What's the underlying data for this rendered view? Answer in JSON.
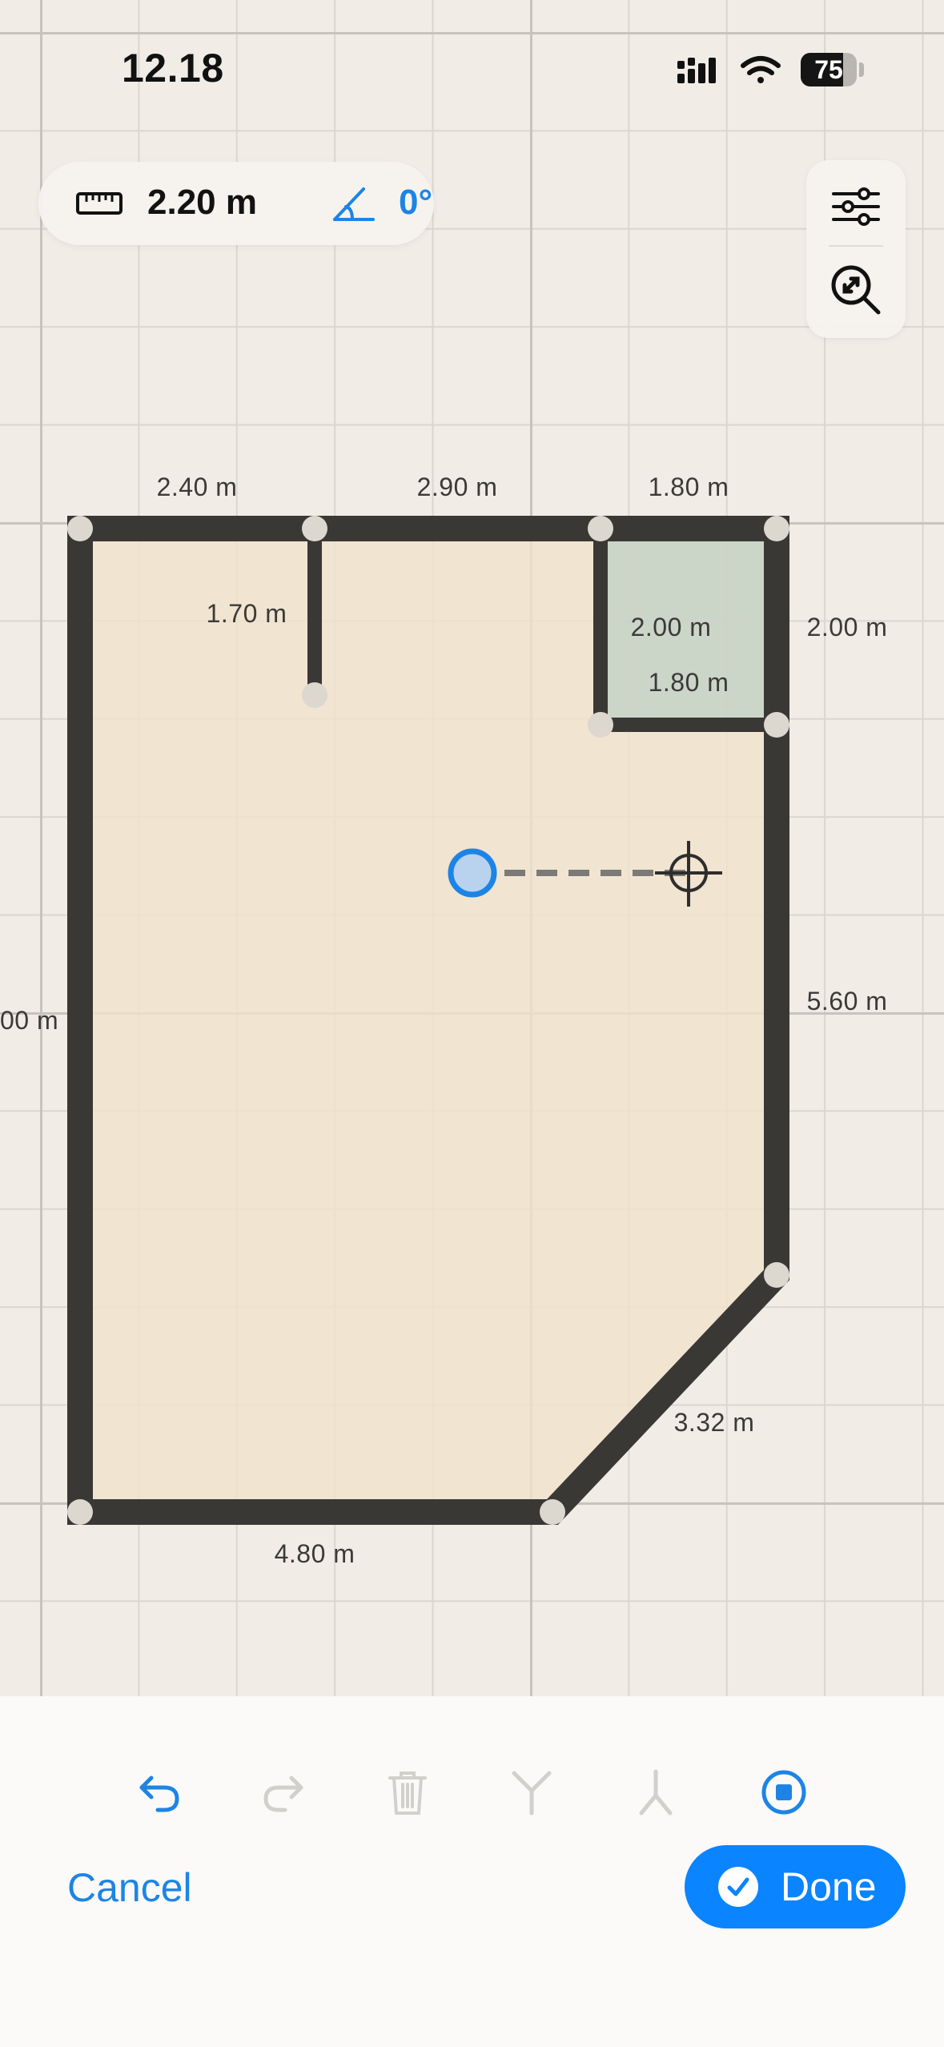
{
  "status_bar": {
    "time": "12.18",
    "battery_level": "75",
    "battery_fraction": 0.75
  },
  "measurement": {
    "length": "2.20 m",
    "angle": "0°",
    "length_icon": "ruler-icon",
    "angle_icon": "angle-icon"
  },
  "canvas_tools": {
    "settings_icon": "sliders-icon",
    "zoom_icon": "zoom-to-fit-icon"
  },
  "floor_plan": {
    "wall_labels": {
      "top_left": "2.40 m",
      "top_middle": "2.90 m",
      "top_right": "1.80 m",
      "partition": "1.70 m",
      "closet_height": "2.00 m",
      "closet_width": "1.80 m",
      "right_upper": "2.00 m",
      "right_lower": "5.60 m",
      "left_partial": "00 m",
      "diagonal": "3.32 m",
      "bottom": "4.80 m"
    },
    "colors": {
      "wall": "#3a3835",
      "room_fill": "#f0e2cc",
      "closet_fill": "#c6d3c6",
      "node": "#dcd7cf",
      "active_point": "#1d84e6",
      "grid_major": "#c7c3bd",
      "grid_minor": "#dad6d0"
    }
  },
  "toolbar": {
    "undo_icon": "undo-icon",
    "redo_icon": "redo-icon",
    "delete_icon": "trash-icon",
    "split_icon": "split-wall-icon",
    "merge_icon": "merge-icon",
    "stop_icon": "stop-icon"
  },
  "actions": {
    "cancel_label": "Cancel",
    "done_label": "Done",
    "accent": "#0a84ff"
  }
}
